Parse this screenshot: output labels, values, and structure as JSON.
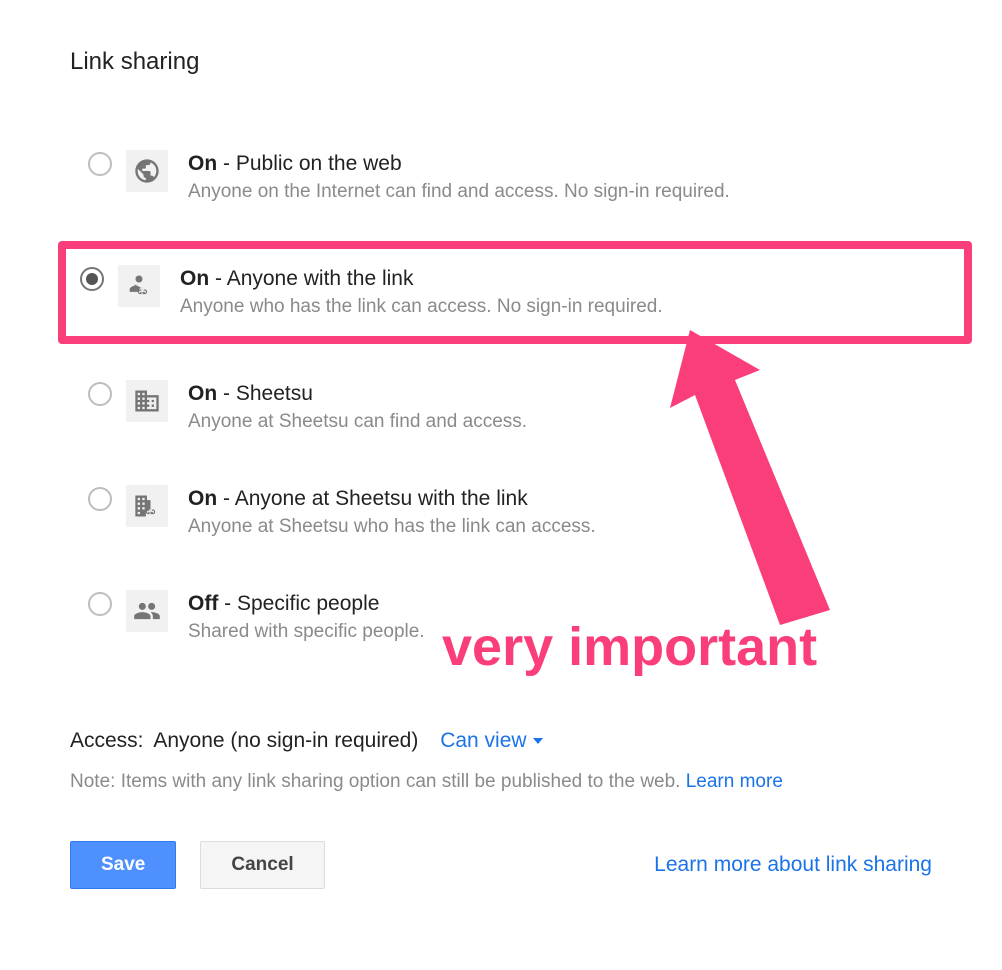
{
  "title": "Link sharing",
  "options": [
    {
      "status": "On",
      "label": "Public on the web",
      "desc": "Anyone on the Internet can find and access. No sign-in required.",
      "selected": false
    },
    {
      "status": "On",
      "label": "Anyone with the link",
      "desc": "Anyone who has the link can access. No sign-in required.",
      "selected": true
    },
    {
      "status": "On",
      "label": "Sheetsu",
      "desc": "Anyone at Sheetsu can find and access.",
      "selected": false
    },
    {
      "status": "On",
      "label": "Anyone at Sheetsu with the link",
      "desc": "Anyone at Sheetsu who has the link can access.",
      "selected": false
    },
    {
      "status": "Off",
      "label": "Specific people",
      "desc": "Shared with specific people.",
      "selected": false
    }
  ],
  "access": {
    "label": "Access:",
    "value": "Anyone (no sign-in required)",
    "permission": "Can view"
  },
  "note": {
    "text": "Note: Items with any link sharing option can still be published to the web. ",
    "link": "Learn more"
  },
  "buttons": {
    "save": "Save",
    "cancel": "Cancel"
  },
  "footer_link": "Learn more about link sharing",
  "annotation": "very important",
  "colors": {
    "accent_pink": "#f93e7a",
    "link_blue": "#1a73e8",
    "primary_button": "#4d90fe"
  }
}
